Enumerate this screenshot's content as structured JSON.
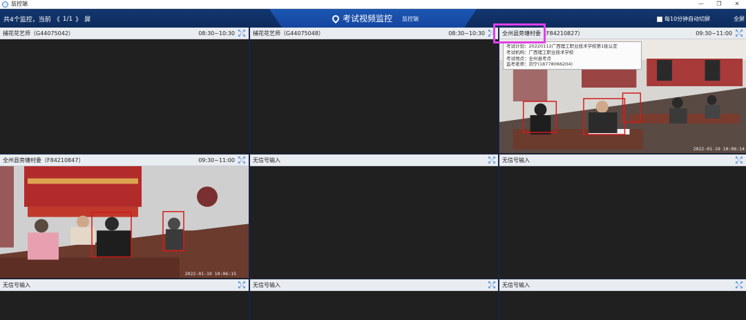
{
  "window": {
    "title": "监控端",
    "buttons": [
      "—",
      "❐",
      "✕"
    ]
  },
  "header": {
    "count_text": "共4个监控，当前",
    "prev": "《",
    "page": "1/1",
    "next": "》",
    "page_suffix": "屏",
    "title": "考试视频监控",
    "subtitle": "监控端",
    "autoswitch_label": "每10分钟自动切屏",
    "fullscreen_label": "全屏"
  },
  "cells": [
    {
      "name": "捕花花艺师（G44075042）",
      "time": "08:30~10:30",
      "has_video": false
    },
    {
      "name": "捕花花艺师（G44075048）",
      "time": "08:30~10:30",
      "has_video": false
    },
    {
      "name": "全州县旁塘村委（F84210827）",
      "time": "09:30~11:00",
      "has_video": true,
      "stamp": "2022-01-19  10:06:14"
    },
    {
      "name": "全州县旁塘村委（F84210847）",
      "time": "09:30~11:00",
      "has_video": true,
      "stamp": "2022-01-19  10:06:15"
    },
    {
      "name": "无信号输入",
      "time": "",
      "has_video": false
    },
    {
      "name": "无信号输入",
      "time": "",
      "has_video": false
    },
    {
      "name": "无信号输入",
      "time": "",
      "has_video": false
    },
    {
      "name": "无信号输入",
      "time": "",
      "has_video": false
    },
    {
      "name": "无信号输入",
      "time": "",
      "has_video": false
    }
  ],
  "tooltip": {
    "lines": [
      "考试计划：20220112广西理工职业技术学校第1批认定",
      "考试机构：广西理工职业技术学校",
      "考试地点：全州县考点",
      "监考老师：刘宁(18778066204)"
    ]
  },
  "colors": {
    "header_bg": "#0e2c5d",
    "tab_bg": "#1646a0",
    "highlight": "#e040e8",
    "detection": "#d11a1a"
  }
}
